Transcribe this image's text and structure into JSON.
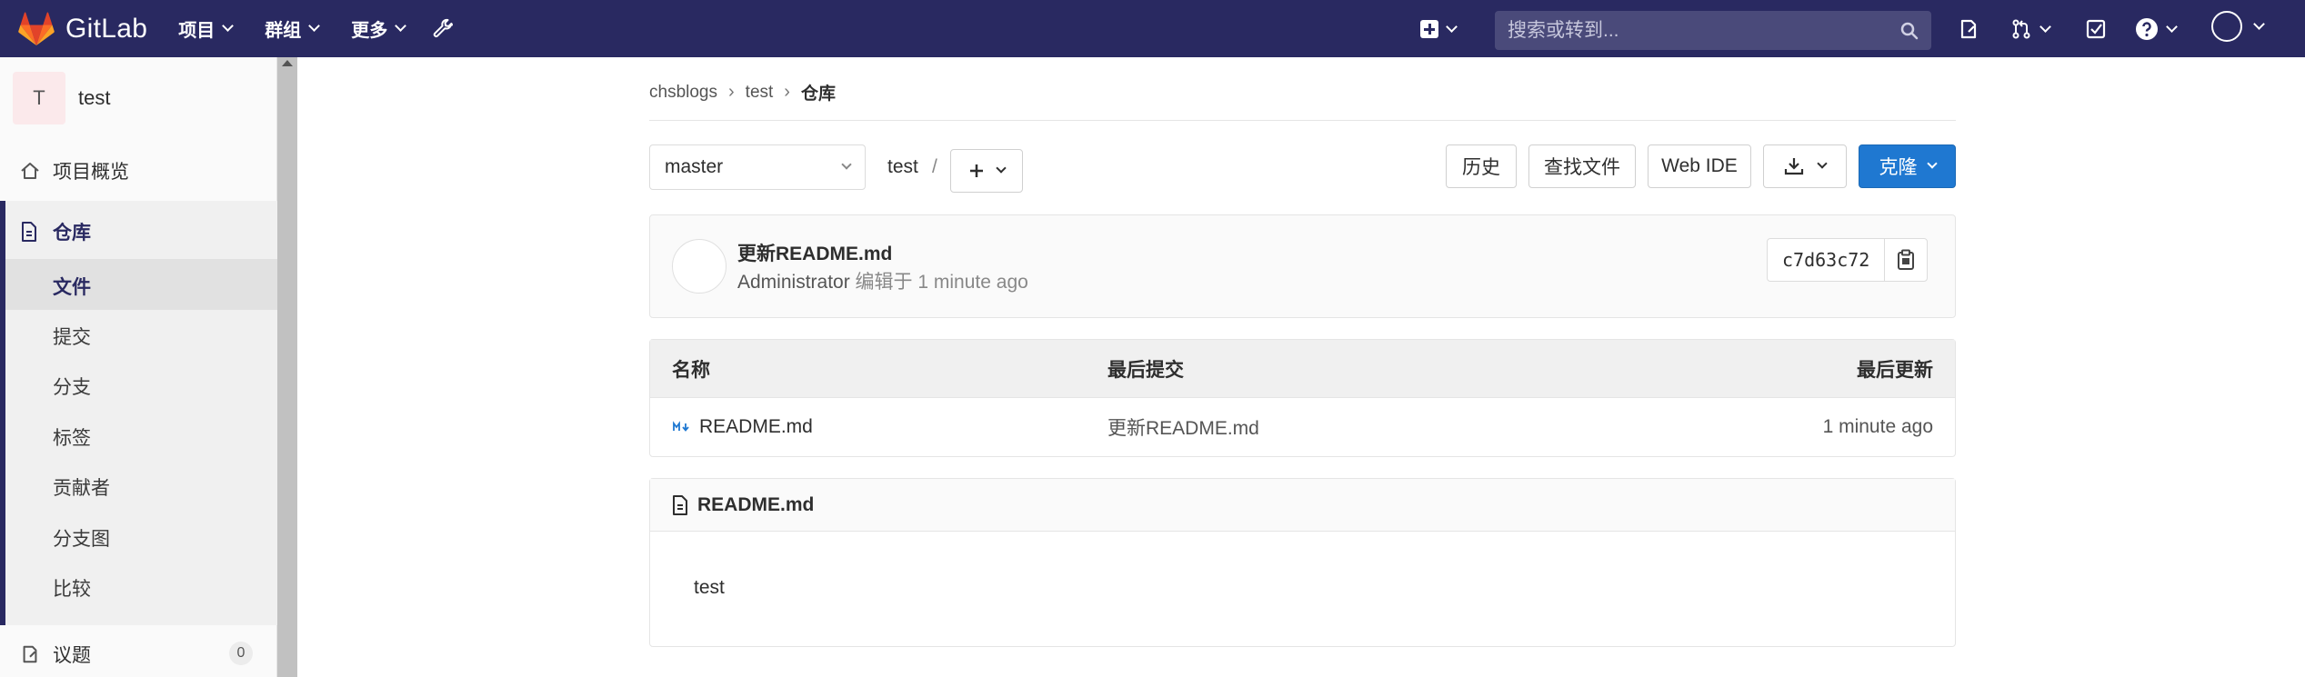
{
  "navbar": {
    "brand": "GitLab",
    "menu": [
      {
        "label": "项目"
      },
      {
        "label": "群组"
      },
      {
        "label": "更多"
      }
    ],
    "search_placeholder": "搜索或转到..."
  },
  "sidebar": {
    "project_avatar_letter": "T",
    "project_name": "test",
    "overview_label": "项目概览",
    "repo_label": "仓库",
    "sub_items": [
      "文件",
      "提交",
      "分支",
      "标签",
      "贡献者",
      "分支图",
      "比较"
    ],
    "issues_label": "议题",
    "issues_count": "0"
  },
  "breadcrumb": {
    "group": "chsblogs",
    "project": "test",
    "current": "仓库"
  },
  "toolbar": {
    "branch": "master",
    "path": "test",
    "path_sep": "/",
    "history": "历史",
    "find_file": "查找文件",
    "web_ide": "Web IDE",
    "clone": "克隆"
  },
  "commit": {
    "title": "更新README.md",
    "author": "Administrator",
    "meta": "编辑于 1 minute ago",
    "sha": "c7d63c72"
  },
  "files": {
    "headers": {
      "name": "名称",
      "last_commit": "最后提交",
      "last_update": "最后更新"
    },
    "rows": [
      {
        "name": "README.md",
        "commit": "更新README.md",
        "updated": "1 minute ago"
      }
    ]
  },
  "readme": {
    "title": "README.md",
    "body": "test"
  },
  "colors": {
    "navbar": "#292961",
    "primary": "#1f78d1",
    "markdown_icon": "#1f78d1"
  }
}
